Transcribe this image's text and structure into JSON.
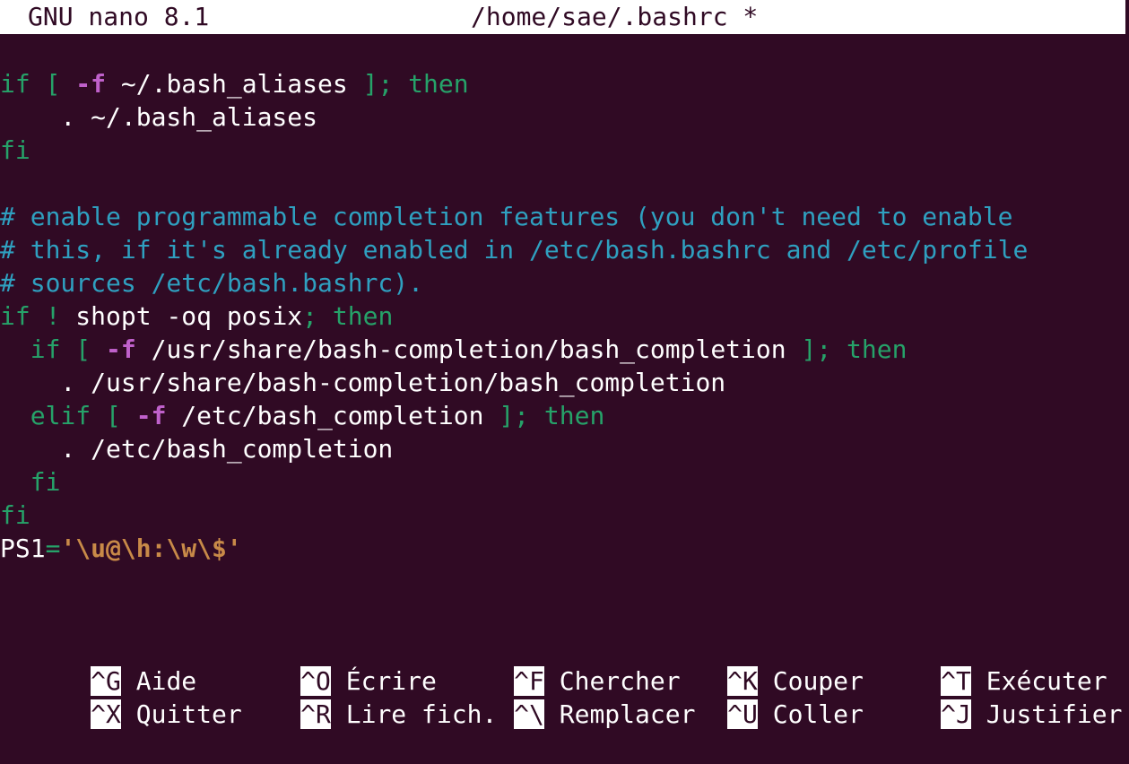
{
  "colors": {
    "background": "#300a24",
    "titlebar_bg": "#ffffff",
    "comment": "#2fa0c0",
    "keyword": "#26a269",
    "option": "#c061cb",
    "string": "#c88a48",
    "text": "#ffffff"
  },
  "titlebar": {
    "app": "GNU nano 8.1",
    "file": "/home/sae/.bashrc *"
  },
  "lines": [
    [
      [
        "kw",
        "if ["
      ],
      [
        "txt",
        " "
      ],
      [
        "opt",
        "-f"
      ],
      [
        "txt",
        " ~/.bash_aliases "
      ],
      [
        "kw",
        "]; then"
      ]
    ],
    [
      [
        "txt",
        "    . ~/.bash_aliases"
      ]
    ],
    [
      [
        "kw",
        "fi"
      ]
    ],
    [],
    [
      [
        "cmt",
        "# enable programmable completion features (you don't need to enable"
      ]
    ],
    [
      [
        "cmt",
        "# this, if it's already enabled in /etc/bash.bashrc and /etc/profile"
      ]
    ],
    [
      [
        "cmt",
        "# sources /etc/bash.bashrc)."
      ]
    ],
    [
      [
        "kw",
        "if !"
      ],
      [
        "txt",
        " shopt -oq posix"
      ],
      [
        "kw",
        "; then"
      ]
    ],
    [
      [
        "kw",
        "  if ["
      ],
      [
        "txt",
        " "
      ],
      [
        "opt",
        "-f"
      ],
      [
        "txt",
        " /usr/share/bash-completion/bash_completion "
      ],
      [
        "kw",
        "]; then"
      ]
    ],
    [
      [
        "txt",
        "    . /usr/share/bash-completion/bash_completion"
      ]
    ],
    [
      [
        "kw",
        "  elif ["
      ],
      [
        "txt",
        " "
      ],
      [
        "opt",
        "-f"
      ],
      [
        "txt",
        " /etc/bash_completion "
      ],
      [
        "kw",
        "]; then"
      ]
    ],
    [
      [
        "txt",
        "    . /etc/bash_completion"
      ]
    ],
    [
      [
        "kw",
        "  fi"
      ]
    ],
    [
      [
        "kw",
        "fi"
      ]
    ],
    [
      [
        "txt",
        "PS1"
      ],
      [
        "kw",
        "="
      ],
      [
        "str",
        "'\\u@\\h:\\w\\$'"
      ]
    ]
  ],
  "shortcuts": {
    "row1": [
      {
        "key": "^G",
        "label": "Aide"
      },
      {
        "key": "^O",
        "label": "Écrire"
      },
      {
        "key": "^F",
        "label": "Chercher"
      },
      {
        "key": "^K",
        "label": "Couper"
      },
      {
        "key": "^T",
        "label": "Exécuter"
      }
    ],
    "row2": [
      {
        "key": "^X",
        "label": "Quitter"
      },
      {
        "key": "^R",
        "label": "Lire fich."
      },
      {
        "key": "^\\",
        "label": "Remplacer"
      },
      {
        "key": "^U",
        "label": "Coller"
      },
      {
        "key": "^J",
        "label": "Justifier"
      }
    ]
  }
}
